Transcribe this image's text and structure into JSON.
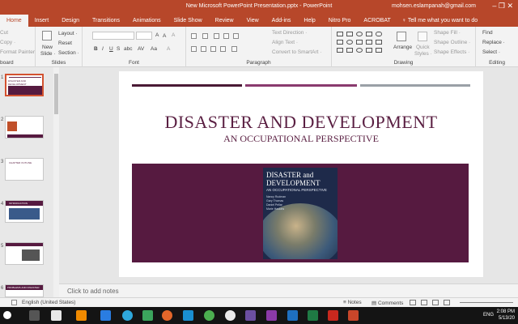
{
  "window": {
    "title": "New Microsoft PowerPoint Presentation.pptx  -  PowerPoint",
    "user": "mohsen.eslampanah@gmail.com",
    "controls": "–   ❐   ✕"
  },
  "tabs": [
    {
      "label": "Home",
      "active": true
    },
    {
      "label": "Insert"
    },
    {
      "label": "Design"
    },
    {
      "label": "Transitions"
    },
    {
      "label": "Animations"
    },
    {
      "label": "Slide Show"
    },
    {
      "label": "Review"
    },
    {
      "label": "View"
    },
    {
      "label": "Add-ins"
    },
    {
      "label": "Help"
    },
    {
      "label": "Nitro Pro"
    },
    {
      "label": "ACROBAT"
    }
  ],
  "tell_me": "♀ Tell me what you want to do",
  "ribbon": {
    "clipboard": {
      "cut": "Cut",
      "copy": "Copy ·",
      "format_painter": "Format Painter",
      "label": "board"
    },
    "slides": {
      "new_slide": "New",
      "new_slide2": "Slide ·",
      "layout": "Layout ·",
      "reset": "Reset",
      "section": "Section ·",
      "label": "Slides"
    },
    "font": {
      "grow": "A",
      "shrink": "A",
      "clear": "A",
      "bold": "B",
      "italic": "I",
      "underline": "U",
      "strike": "S",
      "shadow": "abc",
      "spacing": "AV",
      "case": "Aa",
      "color": "A",
      "label": "Font"
    },
    "paragraph": {
      "text_direction": "Text Direction ·",
      "align_text": "Align Text ·",
      "smartart": "Convert to SmartArt ·",
      "label": "Paragraph"
    },
    "drawing": {
      "arrange": "Arrange",
      "quick_styles": "Quick",
      "quick_styles2": "Styles ·",
      "shape_fill": "Shape Fill ·",
      "shape_outline": "Shape Outline ·",
      "shape_effects": "Shape Effects ·",
      "label": "Drawing"
    },
    "editing": {
      "find": "Find",
      "replace": "Replace ·",
      "select": "Select ·",
      "label": "Editing"
    }
  },
  "thumbnails": [
    {
      "num": "1",
      "active": true,
      "caption": "DISASTER AND DEVELOPMENT"
    },
    {
      "num": "2",
      "caption": ""
    },
    {
      "num": "3",
      "caption": "CHAPTER OUTLINE"
    },
    {
      "num": "4",
      "caption": "INTRODUCTION"
    },
    {
      "num": "5",
      "caption": ""
    },
    {
      "num": "6",
      "caption": "PROBLEMS AND DISASTER"
    }
  ],
  "slide": {
    "title": "DISASTER AND DEVELOPMENT",
    "subtitle": "AN OCCUPATIONAL PERSPECTIVE",
    "stripe_colors": [
      "#4a1a35",
      "#8a3a6e",
      "#9aa0a6"
    ],
    "band_color": "#561a40",
    "book": {
      "title_line1": "DISASTER and",
      "title_line2": "DEVELOPMENT",
      "subtitle": "AN OCCUPATIONAL PERSPECTIVE",
      "authors": [
        "Nancy Rudman",
        "Gary Thomas",
        "Daniel Pellar",
        "Marie Haskins"
      ]
    }
  },
  "notes_placeholder": "Click to add notes",
  "status": {
    "language": "English (United States)",
    "notes": "≡ Notes",
    "comments": "▤ Comments"
  },
  "tray": {
    "lang": "ENG",
    "time": "2:08 PM",
    "date": "5/13/20"
  }
}
